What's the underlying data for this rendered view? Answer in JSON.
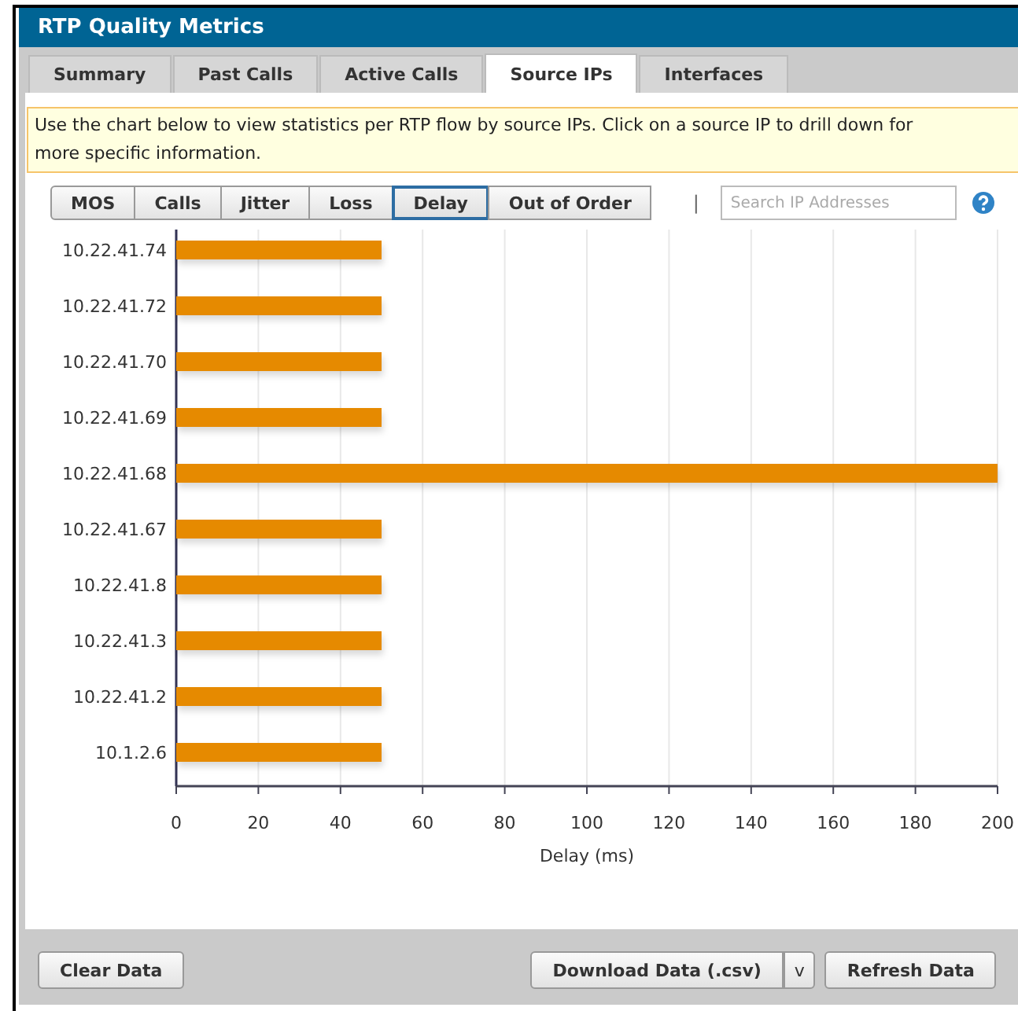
{
  "window": {
    "title": "RTP Quality Metrics"
  },
  "tabs": [
    {
      "label": "Summary",
      "selected": false
    },
    {
      "label": "Past Calls",
      "selected": false
    },
    {
      "label": "Active Calls",
      "selected": false
    },
    {
      "label": "Source IPs",
      "selected": true
    },
    {
      "label": "Interfaces",
      "selected": false
    }
  ],
  "info": [
    "Use the chart below to view statistics per RTP flow by source IPs. Click on a source IP to drill down for",
    "more specific information."
  ],
  "metrics": [
    {
      "label": "MOS",
      "selected": false
    },
    {
      "label": "Calls",
      "selected": false
    },
    {
      "label": "Jitter",
      "selected": false
    },
    {
      "label": "Loss",
      "selected": false
    },
    {
      "label": "Delay",
      "selected": true
    },
    {
      "label": "Out of Order",
      "selected": false
    }
  ],
  "separator": "|",
  "search": {
    "placeholder": "Search IP Addresses"
  },
  "chart": {
    "chart_data": {
      "type": "bar",
      "orientation": "horizontal",
      "xlabel": "Delay (ms)",
      "grid": true,
      "categories": [
        "10.22.41.74",
        "10.22.41.72",
        "10.22.41.70",
        "10.22.41.69",
        "10.22.41.68",
        "10.22.41.67",
        "10.22.41.8",
        "10.22.41.3",
        "10.22.41.2",
        "10.1.2.6"
      ],
      "series": [
        {
          "color": "#e68a00",
          "values": [
            50,
            50,
            50,
            50,
            200,
            50,
            50,
            50,
            50,
            50
          ]
        }
      ],
      "xlim": [
        0,
        200
      ],
      "xticks": [
        0,
        20,
        40,
        60,
        80,
        100,
        120,
        140,
        160,
        180,
        200
      ]
    }
  },
  "footer": {
    "clear": "Clear Data",
    "download": "Download Data (.csv)",
    "download_menu": "v",
    "refresh": "Refresh Data"
  }
}
